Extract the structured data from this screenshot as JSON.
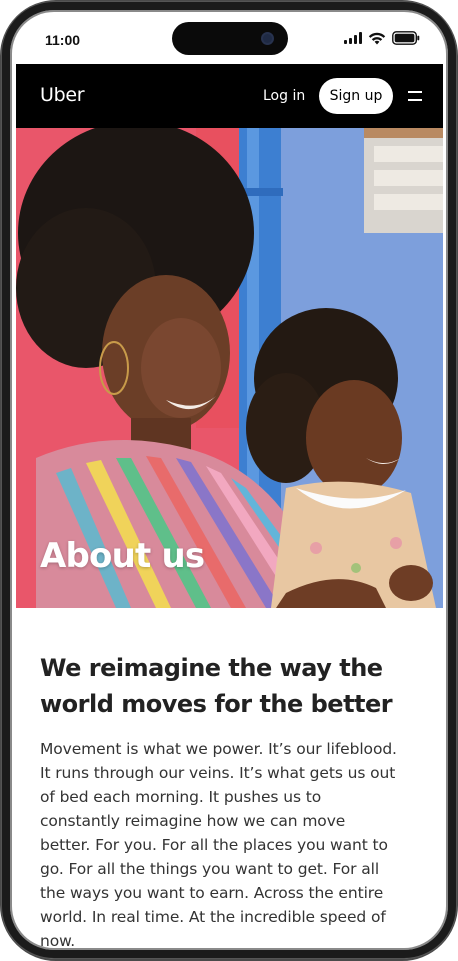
{
  "status_bar": {
    "time": "11:00"
  },
  "navbar": {
    "brand": "Uber",
    "login_label": "Log in",
    "signup_label": "Sign up",
    "menu_icon": "hamburger-menu-icon"
  },
  "hero": {
    "title": "About us",
    "image": "photo of smiling woman holding a young girl"
  },
  "content": {
    "headline": "We reimagine the way the world moves for the better",
    "body": "Movement is what we power. It’s our lifeblood. It runs through our veins. It’s what gets us out of bed each morning. It pushes us to constantly reimagine how we can move better. For you. For all the places you want to go. For all the things you want to get. For all the ways you want to earn. Across the entire world. In real time. At the incredible speed of now."
  },
  "colors": {
    "navbar_bg": "#000000",
    "signup_bg": "#ffffff",
    "text_primary": "#222222"
  }
}
